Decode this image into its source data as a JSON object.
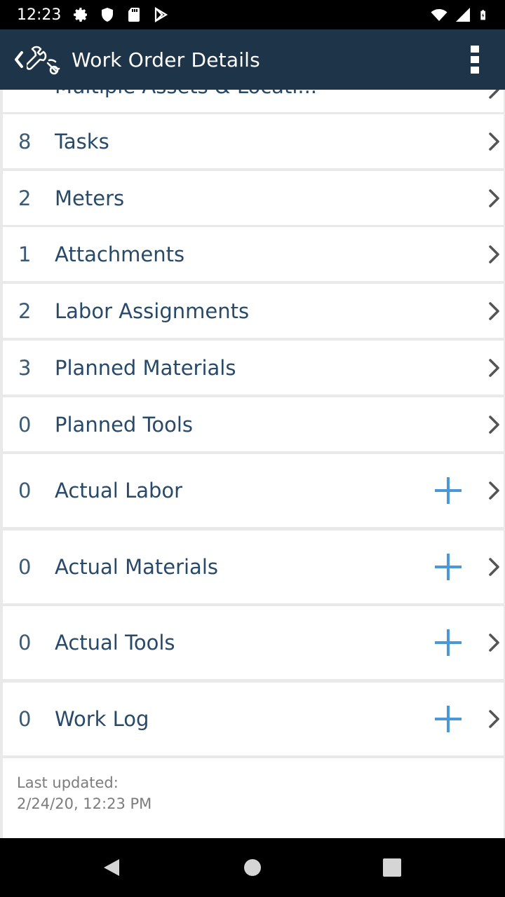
{
  "status_bar": {
    "time": "12:23",
    "left_icons": [
      "gear-icon",
      "shield-icon",
      "sd-card-icon",
      "play-store-icon"
    ],
    "right_icons": [
      "wifi-icon",
      "cell-signal-icon",
      "battery-icon"
    ]
  },
  "app_bar": {
    "title": "Work Order Details",
    "logo_icon": "wrench-gear-icon",
    "menu_icon": "overflow-menu-icon"
  },
  "partial_row": {
    "label": "Multiple Assets & Locati..."
  },
  "rows": [
    {
      "count": "8",
      "label": "Tasks",
      "add": false
    },
    {
      "count": "2",
      "label": "Meters",
      "add": false
    },
    {
      "count": "1",
      "label": "Attachments",
      "add": false
    },
    {
      "count": "2",
      "label": "Labor Assignments",
      "add": false
    },
    {
      "count": "3",
      "label": "Planned Materials",
      "add": false
    },
    {
      "count": "0",
      "label": "Planned Tools",
      "add": false
    },
    {
      "count": "0",
      "label": "Actual Labor",
      "add": true
    },
    {
      "count": "0",
      "label": "Actual Materials",
      "add": true
    },
    {
      "count": "0",
      "label": "Actual Tools",
      "add": true
    },
    {
      "count": "0",
      "label": "Work Log",
      "add": true
    }
  ],
  "footer": {
    "label": "Last updated:",
    "timestamp": "2/24/20,   12:23 PM"
  },
  "colors": {
    "app_bar": "#1e3448",
    "accent_plus": "#4a98d8",
    "label_text": "#27496a"
  }
}
